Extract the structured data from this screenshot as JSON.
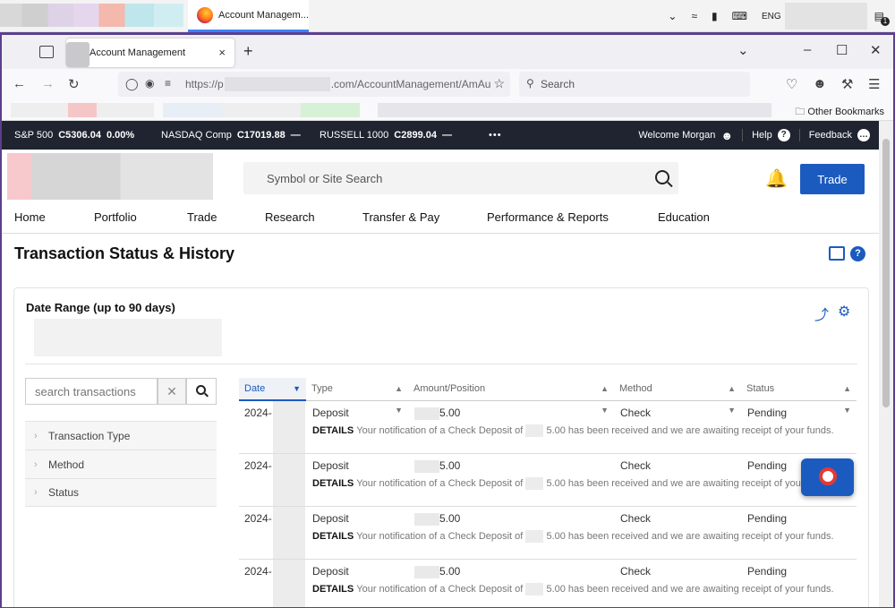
{
  "os": {
    "tab_title": "Account Managem...",
    "language": "ENG",
    "notification_count": "1"
  },
  "browser": {
    "tab_title": "Account Management",
    "tab_close": "×",
    "new_tab": "+",
    "url_prefix": "https://p",
    "url_suffix": ".com/AccountManagement/AmAu",
    "search_placeholder": "Search",
    "other_bookmarks": "Other Bookmarks"
  },
  "ticker": {
    "items": [
      {
        "name": "S&P 500",
        "value": "C5306.04",
        "change": "0.00%"
      },
      {
        "name": "NASDAQ Comp",
        "value": "C17019.88",
        "change": "—"
      },
      {
        "name": "RUSSELL 1000",
        "value": "C2899.04",
        "change": "—"
      }
    ],
    "more": "•••",
    "welcome": "Welcome Morgan",
    "help": "Help",
    "feedback": "Feedback"
  },
  "header": {
    "search_placeholder": "Symbol or Site Search",
    "trade_label": "Trade"
  },
  "nav": [
    "Home",
    "Portfolio",
    "Trade",
    "Research",
    "Transfer & Pay",
    "Performance & Reports",
    "Education"
  ],
  "page": {
    "title": "Transaction Status & History",
    "date_range_label": "Date Range (up to 90 days)"
  },
  "sidebar": {
    "search_placeholder": "search transactions",
    "clear_label": "✕",
    "filters": [
      "Transaction Type",
      "Method",
      "Status"
    ]
  },
  "table": {
    "columns": [
      "Date",
      "Type",
      "Amount/Position",
      "Method",
      "Status"
    ],
    "rows": [
      {
        "date": "2024-",
        "type": "Deposit",
        "amount": "5.00",
        "method": "Check",
        "status": "Pending",
        "details_label": "DETAILS",
        "details_a": "Your notification of a Check Deposit of",
        "details_b": "5.00 has been received and we are awaiting receipt of your funds."
      },
      {
        "date": "2024-",
        "type": "Deposit",
        "amount": "5.00",
        "method": "Check",
        "status": "Pending",
        "details_label": "DETAILS",
        "details_a": "Your notification of a Check Deposit of",
        "details_b": "5.00 has been received and we are awaiting receipt of your funds."
      },
      {
        "date": "2024-",
        "type": "Deposit",
        "amount": "5.00",
        "method": "Check",
        "status": "Pending",
        "details_label": "DETAILS",
        "details_a": "Your notification of a Check Deposit of",
        "details_b": "5.00 has been received and we are awaiting receipt of your funds."
      },
      {
        "date": "2024-",
        "type": "Deposit",
        "amount": "5.00",
        "method": "Check",
        "status": "Pending",
        "details_label": "DETAILS",
        "details_a": "Your notification of a Check Deposit of",
        "details_b": "5.00 has been received and we are awaiting receipt of your funds."
      }
    ]
  },
  "colors": {
    "brand_blue": "#1b5bbf",
    "ticker_bg": "#1f2430",
    "window_border": "#5b3f8c"
  }
}
